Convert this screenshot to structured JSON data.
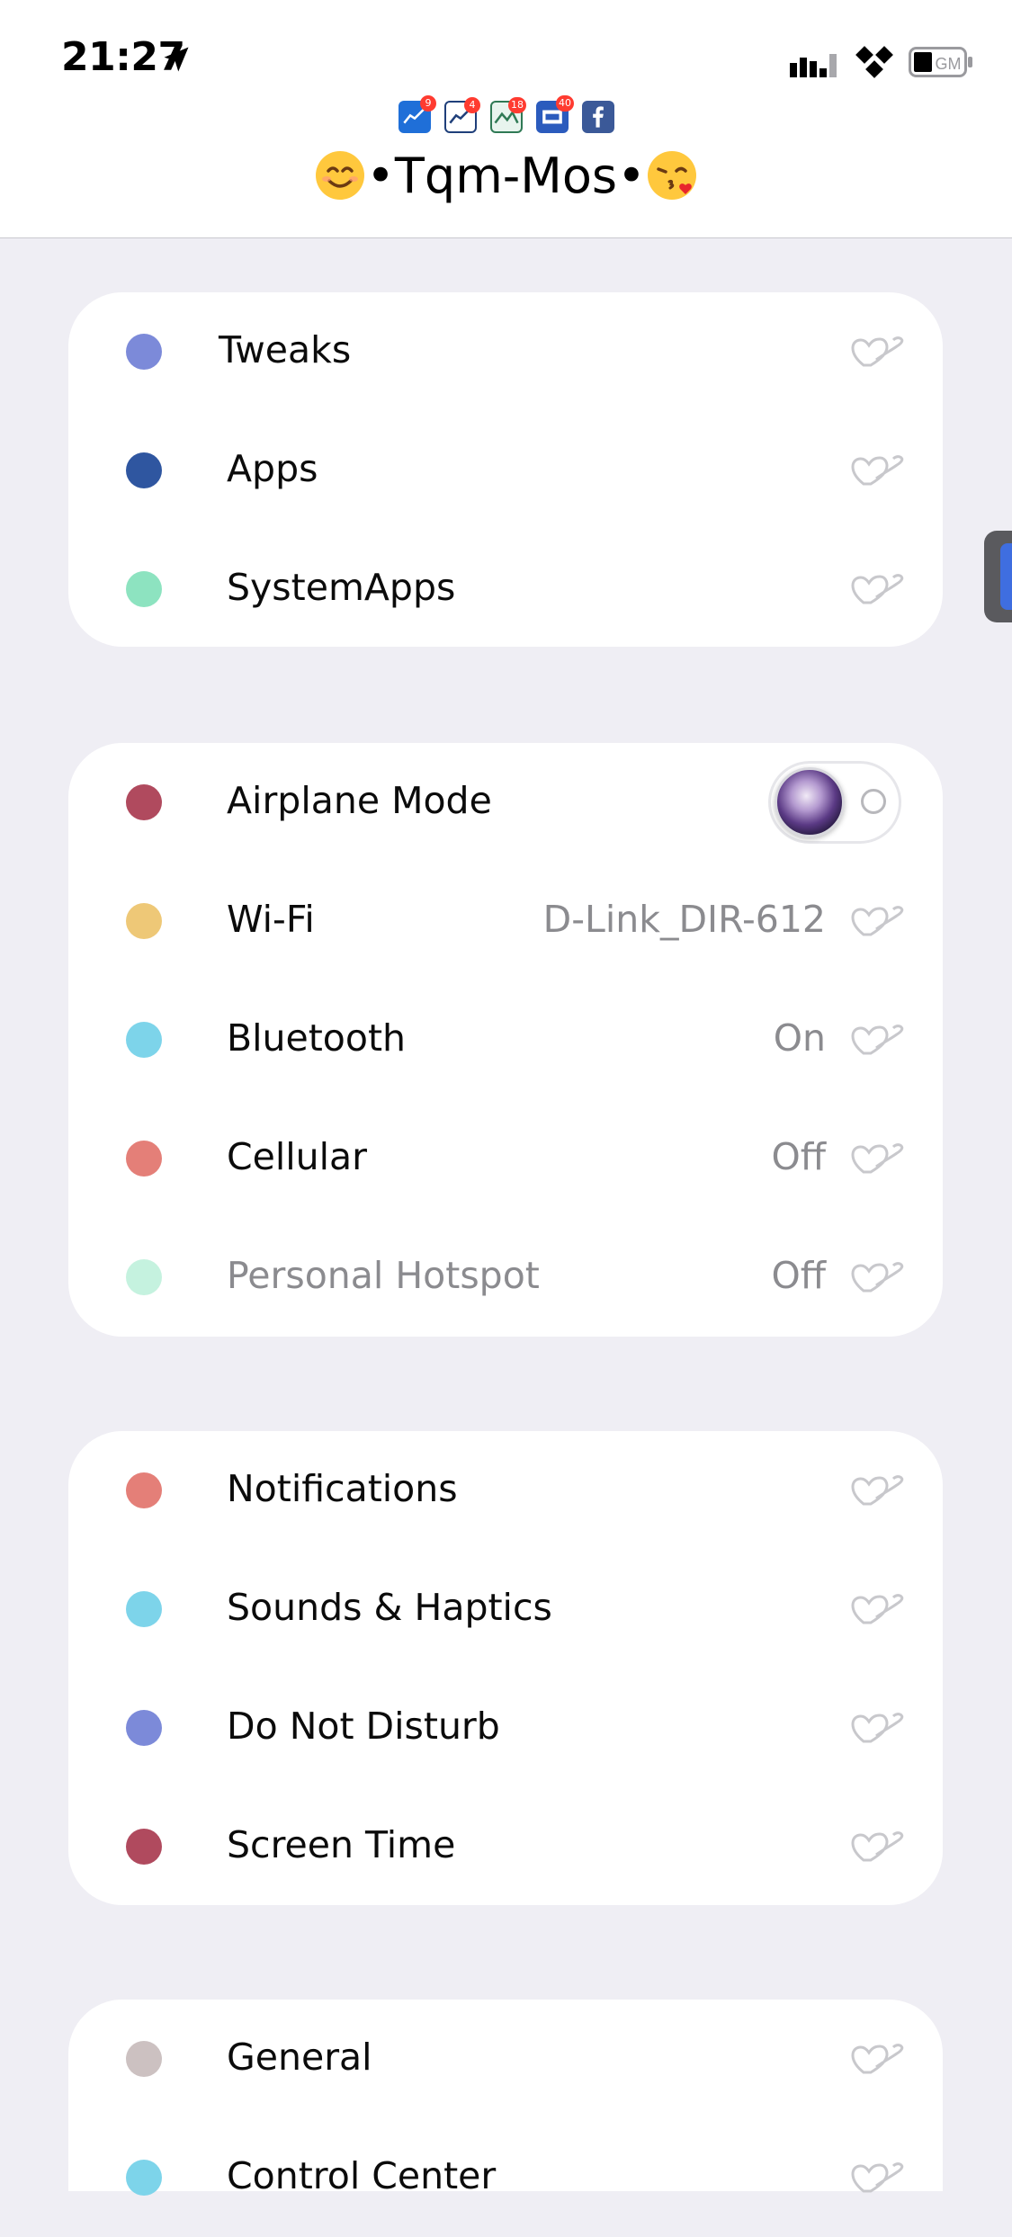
{
  "status_bar": {
    "time": "21:27",
    "battery_label": "GM"
  },
  "header": {
    "title": "•Tqm-Mos•",
    "app_badges": [
      {
        "icon": "stocks-chart-icon",
        "badge": "9",
        "bg": "#1f6fd8"
      },
      {
        "icon": "stocks-chart-icon",
        "badge": "4",
        "bg": "#ffffff"
      },
      {
        "icon": "photo-frame-icon",
        "badge": "18",
        "bg": "#e8f4ee"
      },
      {
        "icon": "dmg-box-icon",
        "badge": "40",
        "bg": "#2b5bbd"
      },
      {
        "icon": "facebook-icon",
        "badge": "",
        "bg": "#3b5998"
      }
    ]
  },
  "groups": [
    {
      "rows": [
        {
          "label": "Tweaks",
          "color": "#7c8ad9"
        },
        {
          "label": "Apps",
          "color": "#2f56a0"
        },
        {
          "label": "SystemApps",
          "color": "#8de3c0"
        }
      ]
    },
    {
      "rows": [
        {
          "label": "Airplane Mode",
          "color": "#b04a5e",
          "toggle": "off"
        },
        {
          "label": "Wi-Fi",
          "color": "#eec877",
          "value": "D-Link_DIR-612"
        },
        {
          "label": "Bluetooth",
          "color": "#7dd4ea",
          "value": "On"
        },
        {
          "label": "Cellular",
          "color": "#e47f78",
          "value": "Off"
        },
        {
          "label": "Personal Hotspot",
          "color": "#c5f2df",
          "value": "Off",
          "disabled": true
        }
      ]
    },
    {
      "rows": [
        {
          "label": "Notifications",
          "color": "#e47f78"
        },
        {
          "label": "Sounds & Haptics",
          "color": "#7dd4ea"
        },
        {
          "label": "Do Not Disturb",
          "color": "#7c8ad9"
        },
        {
          "label": "Screen Time",
          "color": "#b04a5e"
        }
      ]
    },
    {
      "rows": [
        {
          "label": "General",
          "color": "#ccc1c1"
        },
        {
          "label": "Control Center",
          "color": "#7dd4ea"
        }
      ]
    }
  ]
}
